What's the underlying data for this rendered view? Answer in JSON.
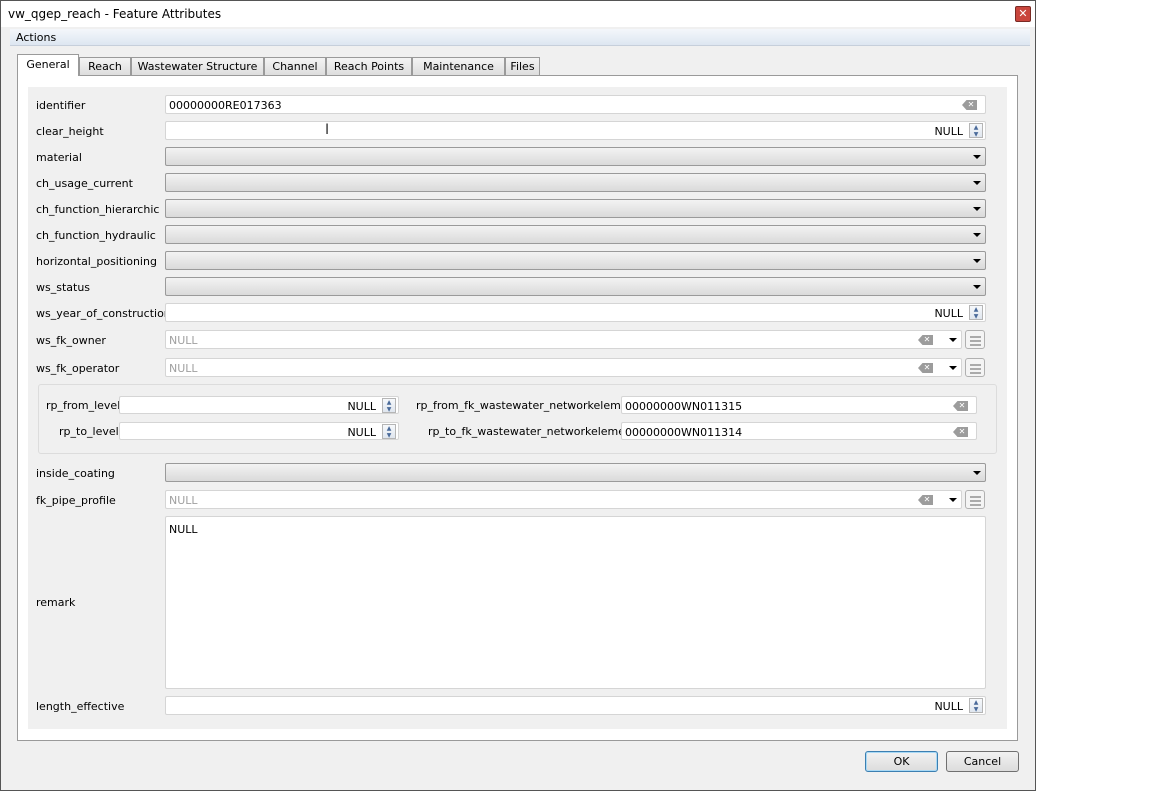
{
  "window": {
    "title": "vw_qgep_reach - Feature Attributes",
    "close_icon": "close-icon"
  },
  "menu": {
    "actions": "Actions"
  },
  "tabs": [
    "General",
    "Reach",
    "Wastewater Structure",
    "Channel",
    "Reach Points",
    "Maintenance",
    "Files"
  ],
  "active_tab": "General",
  "fields": [
    {
      "label": "identifier",
      "type": "text",
      "value": "00000000RE017363"
    },
    {
      "label": "clear_height",
      "type": "spin",
      "value": "NULL"
    },
    {
      "label": "material",
      "type": "combo",
      "value": ""
    },
    {
      "label": "ch_usage_current",
      "type": "combo",
      "value": ""
    },
    {
      "label": "ch_function_hierarchic",
      "type": "combo",
      "value": ""
    },
    {
      "label": "ch_function_hydraulic",
      "type": "combo",
      "value": ""
    },
    {
      "label": "horizontal_positioning",
      "type": "combo",
      "value": ""
    },
    {
      "label": "ws_status",
      "type": "combo",
      "value": ""
    },
    {
      "label": "ws_year_of_construction",
      "type": "spin",
      "value": "NULL"
    },
    {
      "label": "ws_fk_owner",
      "type": "relation",
      "placeholder": "NULL"
    },
    {
      "label": "ws_fk_operator",
      "type": "relation",
      "placeholder": "NULL"
    },
    {
      "label": "inside_coating",
      "type": "combo",
      "value": ""
    },
    {
      "label": "fk_pipe_profile",
      "type": "relation",
      "placeholder": "NULL"
    },
    {
      "label": "remark",
      "type": "textarea",
      "value": "NULL"
    },
    {
      "label": "length_effective",
      "type": "spin",
      "value": "NULL"
    }
  ],
  "reach_points": {
    "rp_from_level": {
      "label": "rp_from_level",
      "value": "NULL"
    },
    "rp_to_level": {
      "label": "rp_to_level",
      "value": "NULL"
    },
    "rp_from_fk": {
      "label": "rp_from_fk_wastewater_networkelement",
      "value": "00000000WN011315"
    },
    "rp_to_fk": {
      "label": "rp_to_fk_wastewater_networkelement",
      "value": "00000000WN011314"
    }
  },
  "buttons": {
    "ok": "OK",
    "cancel": "Cancel"
  }
}
